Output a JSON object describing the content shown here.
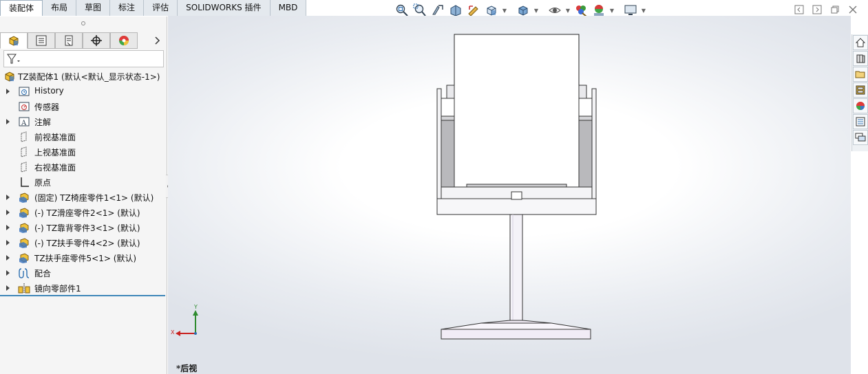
{
  "tabs": [
    {
      "label": "装配体",
      "active": true
    },
    {
      "label": "布局"
    },
    {
      "label": "草图"
    },
    {
      "label": "标注"
    },
    {
      "label": "评估"
    },
    {
      "label": "SOLIDWORKS 插件"
    },
    {
      "label": "MBD"
    }
  ],
  "heads_up_toolbar": [
    "zoom-to-fit-icon",
    "zoom-to-area-icon",
    "previous-view-icon",
    "section-view-icon",
    "dynamic-annotation-icon",
    "view-orientation-icon",
    "display-style-icon",
    "hide-show-items-icon",
    "edit-appearance-icon",
    "apply-scene-icon",
    "view-settings-icon"
  ],
  "manager_tabs": [
    "featuremanager-icon",
    "propertymanager-icon",
    "configurationmanager-icon",
    "dimxpertmanager-icon",
    "displaymanager-icon"
  ],
  "tree": {
    "root": "TZ装配体1  (默认<默认_显示状态-1>)",
    "items": [
      {
        "label": "History",
        "expandable": true,
        "icon": "history-icon"
      },
      {
        "label": "传感器",
        "expandable": false,
        "icon": "sensor-icon"
      },
      {
        "label": "注解",
        "expandable": true,
        "icon": "annotation-icon"
      },
      {
        "label": "前视基准面",
        "expandable": false,
        "icon": "plane-icon"
      },
      {
        "label": "上视基准面",
        "expandable": false,
        "icon": "plane-icon"
      },
      {
        "label": "右视基准面",
        "expandable": false,
        "icon": "plane-icon"
      },
      {
        "label": "原点",
        "expandable": false,
        "icon": "origin-icon"
      },
      {
        "label": "(固定) TZ椅座零件1<1> (默认)",
        "expandable": true,
        "icon": "part-icon"
      },
      {
        "label": "(-) TZ滑座零件2<1> (默认)",
        "expandable": true,
        "icon": "part-icon"
      },
      {
        "label": "(-) TZ靠背零件3<1> (默认)",
        "expandable": true,
        "icon": "part-icon"
      },
      {
        "label": "(-) TZ扶手零件4<2> (默认)",
        "expandable": true,
        "icon": "part-icon"
      },
      {
        "label": "TZ扶手座零件5<1> (默认)",
        "expandable": true,
        "icon": "part-icon"
      },
      {
        "label": "配合",
        "expandable": true,
        "icon": "mates-icon"
      },
      {
        "label": "镜向零部件1",
        "expandable": true,
        "icon": "mirror-component-icon"
      }
    ]
  },
  "viewport": {
    "view_name": "*后视",
    "triad": {
      "x_label": "X",
      "y_label": "Y"
    }
  },
  "task_pane": [
    "solidworks-resources-icon",
    "design-library-icon",
    "file-explorer-icon",
    "view-palette-icon",
    "appearances-icon",
    "custom-properties-icon",
    "forum-icon"
  ],
  "colors": {
    "accent": "#3d86b8",
    "axis_y": "#2e8b2e",
    "axis_x": "#c8201e"
  }
}
